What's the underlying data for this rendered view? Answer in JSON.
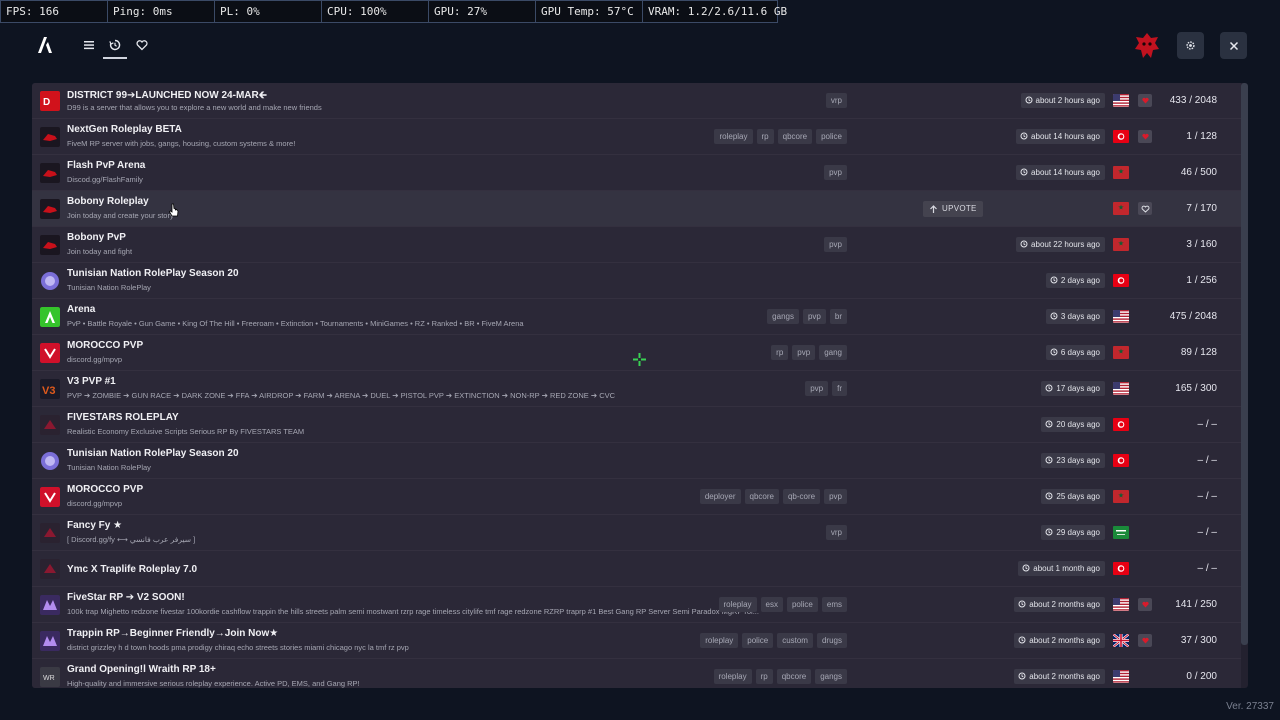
{
  "overlay": {
    "fps": "FPS: 166",
    "ping": "Ping: 0ms",
    "pl": "PL: 0%",
    "cpu": "CPU: 100%",
    "gpu": "GPU: 27%",
    "gpu_temp": "GPU Temp: 57°C",
    "vram": "VRAM: 1.2/2.6/11.6 GB"
  },
  "nav": {
    "items": [
      {
        "icon": "list-icon"
      },
      {
        "icon": "history-icon",
        "active": true
      },
      {
        "icon": "heart-icon"
      }
    ]
  },
  "header": {
    "settings_icon": "gear-icon",
    "close_icon": "close-icon"
  },
  "servers": [
    {
      "name": "DISTRICT 99➔LAUNCHED NOW 24-MAR🡰",
      "desc": "D99 is a server that allows you to explore a new world and make new friends",
      "tags": [
        "vrp"
      ],
      "time": "about 2 hours ago",
      "flag": "us",
      "fav": true,
      "players": "433 / 2048",
      "icon": "d99"
    },
    {
      "name": "NextGen Roleplay BETA",
      "desc": "FiveM RP server with jobs, gangs, housing, custom systems & more!",
      "tags": [
        "roleplay",
        "rp",
        "qbcore",
        "police"
      ],
      "time": "about 14 hours ago",
      "flag": "tn",
      "fav": true,
      "players": "1 / 128",
      "icon": "red"
    },
    {
      "name": "Flash PvP Arena",
      "desc": "Discod.gg/FlashFamily",
      "tags": [
        "pvp"
      ],
      "time": "about 14 hours ago",
      "flag": "ma",
      "fav": false,
      "players": "46 / 500",
      "icon": "red"
    },
    {
      "name": "Bobony Roleplay",
      "desc": "Join today and create your story",
      "tags": [],
      "time": "",
      "flag": "ma",
      "fav": true,
      "players": "7 / 170",
      "icon": "red",
      "hover": true,
      "upvote": "UPVOTE"
    },
    {
      "name": "Bobony PvP",
      "desc": "Join today and fight",
      "tags": [
        "pvp"
      ],
      "time": "about 22 hours ago",
      "flag": "ma",
      "fav": false,
      "players": "3 / 160",
      "icon": "red"
    },
    {
      "name": "Tunisian Nation RolePlay Season 20",
      "desc": "Tunisian Nation RolePlay",
      "tags": [],
      "time": "2 days ago",
      "flag": "tn",
      "fav": false,
      "players": "1 / 256",
      "icon": "purple"
    },
    {
      "name": "Arena",
      "desc": "PvP • Battle Royale • Gun Game • King Of The Hill • Freeroam • Extinction • Tournaments • MiniGames • RZ • Ranked • BR • FiveM Arena",
      "tags": [
        "gangs",
        "pvp",
        "br"
      ],
      "time": "3 days ago",
      "flag": "us",
      "fav": false,
      "players": "475 / 2048",
      "icon": "green"
    },
    {
      "name": "MOROCCO PVP",
      "desc": "discord.gg/mpvp",
      "tags": [
        "rp",
        "pvp",
        "gang"
      ],
      "time": "6 days ago",
      "flag": "ma",
      "fav": false,
      "players": "89 / 128",
      "icon": "redshield"
    },
    {
      "name": "V3 PVP #1",
      "desc": "PVP ➔ ZOMBIE ➔ GUN RACE ➔ DARK ZONE ➔ FFA ➔ AIRDROP ➔ FARM ➔ ARENA ➔ DUEL ➔ PISTOL PVP ➔ EXTINCTION ➔ NON-RP ➔ RED ZONE ➔ CVC",
      "tags": [
        "pvp",
        "fr"
      ],
      "time": "17 days ago",
      "flag": "us",
      "fav": false,
      "players": "165 / 300",
      "icon": "v3"
    },
    {
      "name": "FIVESTARS ROLEPLAY",
      "desc": "Realistic Economy Exclusive Scripts Serious RP By FIVESTARS TEAM",
      "tags": [],
      "time": "20 days ago",
      "flag": "tn",
      "fav": false,
      "players": "– / –",
      "icon": "dark"
    },
    {
      "name": "Tunisian Nation RolePlay Season 20",
      "desc": "Tunisian Nation RolePlay",
      "tags": [],
      "time": "23 days ago",
      "flag": "tn",
      "fav": false,
      "players": "– / –",
      "icon": "purple"
    },
    {
      "name": "MOROCCO PVP",
      "desc": "discord.gg/mpvp",
      "tags": [
        "deployer",
        "qbcore",
        "qb-core",
        "pvp"
      ],
      "time": "25 days ago",
      "flag": "ma",
      "fav": false,
      "players": "– / –",
      "icon": "redshield"
    },
    {
      "name": "Fancy Fy ★",
      "desc": "[ Discord.gg/fy ⟷ سيرفر عرب فانسي ]",
      "tags": [
        "vrp"
      ],
      "time": "29 days ago",
      "flag": "sa",
      "fav": false,
      "players": "– / –",
      "icon": "dark"
    },
    {
      "name": "Ymc X Traplife Roleplay 7.0",
      "desc": "",
      "tags": [],
      "time": "about 1 month ago",
      "flag": "tn",
      "fav": false,
      "players": "– / –",
      "icon": "dark"
    },
    {
      "name": "FiveStar RP ➔ V2 SOON!",
      "desc": "100k trap Mighetto redzone fivestar 100kordie cashflow trappin the hills streets palm semi mostwant rzrp rage timeless citylife tmf rage redzone RZRP traprp #1 Best Gang RP Server Semi Paradox MgRP rol...",
      "tags": [
        "roleplay",
        "esx",
        "police",
        "ems"
      ],
      "time": "about 2 months ago",
      "flag": "us",
      "fav": true,
      "players": "141 / 250",
      "icon": "purple2"
    },
    {
      "name": "Trappin RP→Beginner Friendly→Join Now★",
      "desc": "district grizzley h d town hoods pma prodigy chiraq echo streets stories miami chicago nyc la tmf rz pvp",
      "tags": [
        "roleplay",
        "police",
        "custom",
        "drugs"
      ],
      "time": "about 2 months ago",
      "flag": "gb",
      "fav": true,
      "players": "37 / 300",
      "icon": "purple2"
    },
    {
      "name": "Grand Opening!l Wraith RP 18+",
      "desc": "High-quality and immersive serious roleplay experience. Active PD, EMS, and Gang RP!",
      "tags": [
        "roleplay",
        "rp",
        "qbcore",
        "gangs"
      ],
      "time": "about 2 months ago",
      "flag": "us",
      "fav": false,
      "players": "0 / 200",
      "icon": "grey"
    }
  ],
  "footer": {
    "version": "Ver. 27337"
  }
}
